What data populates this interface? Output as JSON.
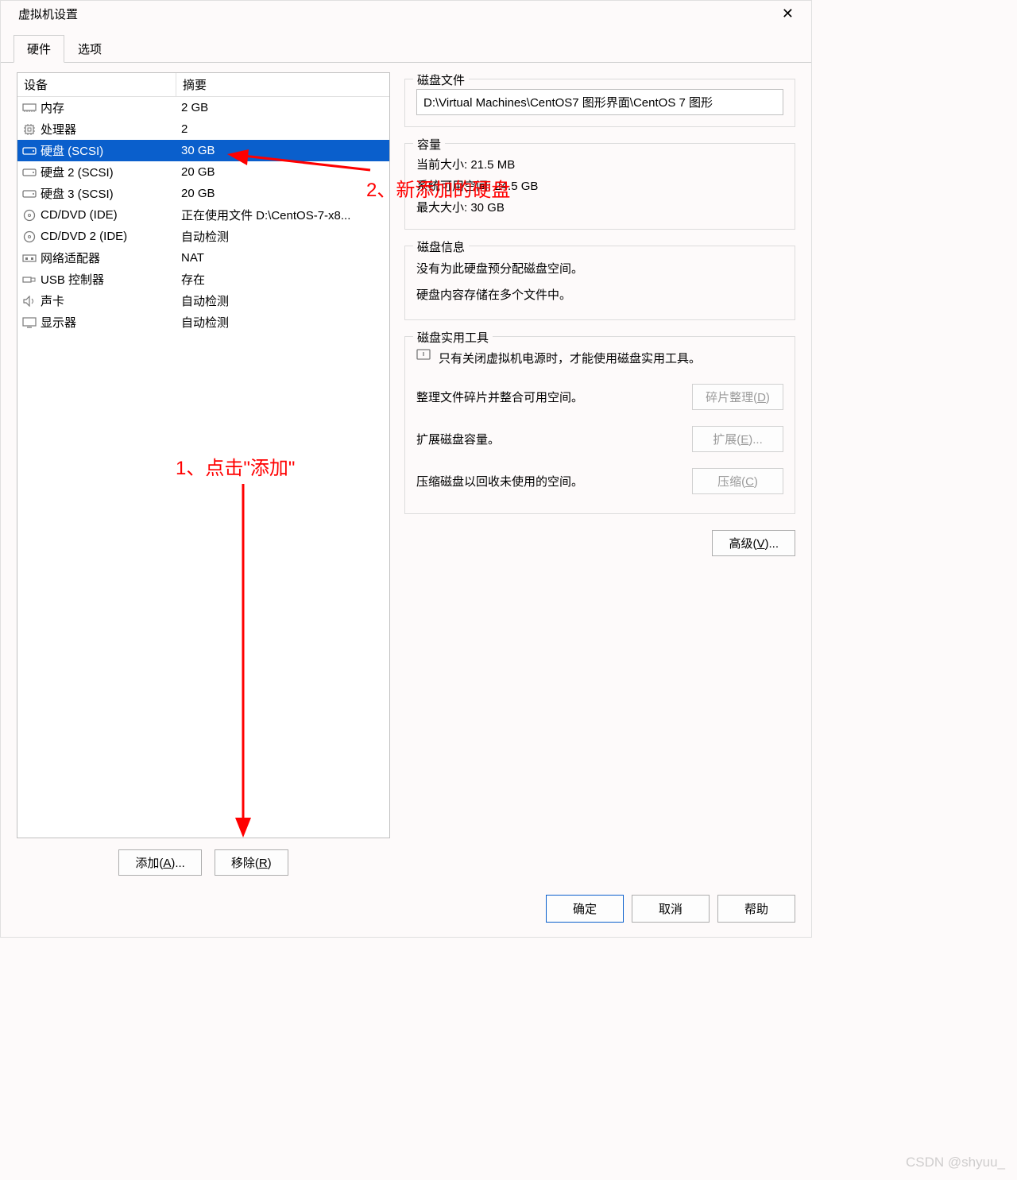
{
  "window_title": "虚拟机设置",
  "tabs": {
    "hardware": "硬件",
    "options": "选项"
  },
  "headers": {
    "device": "设备",
    "summary": "摘要"
  },
  "devices": [
    {
      "icon": "memory",
      "name": "内存",
      "summary": "2 GB",
      "selected": false
    },
    {
      "icon": "cpu",
      "name": "处理器",
      "summary": "2",
      "selected": false
    },
    {
      "icon": "disk",
      "name": "硬盘 (SCSI)",
      "summary": "30 GB",
      "selected": true
    },
    {
      "icon": "disk",
      "name": "硬盘 2 (SCSI)",
      "summary": "20 GB",
      "selected": false
    },
    {
      "icon": "disk",
      "name": "硬盘 3 (SCSI)",
      "summary": "20 GB",
      "selected": false
    },
    {
      "icon": "cd",
      "name": "CD/DVD (IDE)",
      "summary": "正在使用文件 D:\\CentOS-7-x8...",
      "selected": false
    },
    {
      "icon": "cd",
      "name": "CD/DVD 2 (IDE)",
      "summary": "自动检测",
      "selected": false
    },
    {
      "icon": "net",
      "name": "网络适配器",
      "summary": "NAT",
      "selected": false
    },
    {
      "icon": "usb",
      "name": "USB 控制器",
      "summary": "存在",
      "selected": false
    },
    {
      "icon": "sound",
      "name": "声卡",
      "summary": "自动检测",
      "selected": false
    },
    {
      "icon": "display",
      "name": "显示器",
      "summary": "自动检测",
      "selected": false
    }
  ],
  "buttons": {
    "add": "添加(A)...",
    "remove": "移除(R)",
    "defrag": "碎片整理(D)",
    "expand": "扩展(E)...",
    "compact": "压缩(C)",
    "advanced": "高级(V)...",
    "ok": "确定",
    "cancel": "取消",
    "help": "帮助"
  },
  "right": {
    "disk_file_title": "磁盘文件",
    "disk_file_value": "D:\\Virtual Machines\\CentOS7 图形界面\\CentOS 7 图形",
    "capacity_title": "容量",
    "current_size_label": "当前大小: 21.5 MB",
    "sys_free_label": "系统可用空间: 24.5 GB",
    "max_size_label": "最大大小: 30 GB",
    "disk_info_title": "磁盘信息",
    "disk_info_line1": "没有为此硬盘预分配磁盘空间。",
    "disk_info_line2": "硬盘内容存储在多个文件中。",
    "utilities_title": "磁盘实用工具",
    "utilities_note": "只有关闭虚拟机电源时，才能使用磁盘实用工具。",
    "defrag_desc": "整理文件碎片并整合可用空间。",
    "expand_desc": "扩展磁盘容量。",
    "compact_desc": "压缩磁盘以回收未使用的空间。"
  },
  "annotations": {
    "anno1": "1、点击\"添加\"",
    "anno2": "2、新添加的硬盘"
  },
  "watermark": "CSDN @shyuu_"
}
